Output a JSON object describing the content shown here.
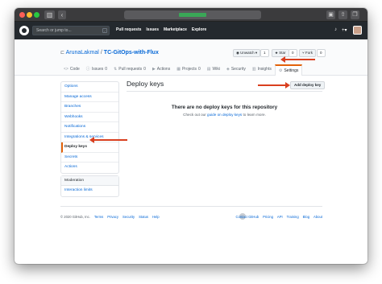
{
  "browser": {
    "nav_back": "‹",
    "nav_sidebar": "▥"
  },
  "header": {
    "search_placeholder": "Search or jump to...",
    "search_kbd": "/",
    "nav": [
      "Pull requests",
      "Issues",
      "Marketplace",
      "Explore"
    ],
    "notifications_icon": "bell-icon",
    "plus_label": "+▾"
  },
  "repo": {
    "owner": "ArunaLakmal",
    "separator": "/",
    "name": "TC-GitOps-with-Flux",
    "unwatch_label": "◉ Unwatch ▾",
    "unwatch_count": "1",
    "star_label": "★ Star",
    "star_count": "0",
    "fork_label": "⑂ Fork",
    "fork_count": "0",
    "tabs": [
      {
        "icon": "<>",
        "label": "Code"
      },
      {
        "icon": "ⓘ",
        "label": "Issues",
        "count": "0"
      },
      {
        "icon": "⇅",
        "label": "Pull requests",
        "count": "0"
      },
      {
        "icon": "▶",
        "label": "Actions"
      },
      {
        "icon": "▦",
        "label": "Projects",
        "count": "0"
      },
      {
        "icon": "▤",
        "label": "Wiki"
      },
      {
        "icon": "◈",
        "label": "Security"
      },
      {
        "icon": "▥",
        "label": "Insights"
      },
      {
        "icon": "⚙",
        "label": "Settings"
      }
    ]
  },
  "sidebar": {
    "items": [
      "Options",
      "Manage access",
      "Branches",
      "Webhooks",
      "Notifications",
      "Integrations & services",
      "Deploy keys",
      "Secrets",
      "Actions"
    ],
    "selected_index": 6,
    "moderation_header": "Moderation",
    "moderation_items": [
      "Interaction limits"
    ]
  },
  "main": {
    "title": "Deploy keys",
    "add_button": "Add deploy key",
    "blank_title": "There are no deploy keys for this repository",
    "blank_sub_prefix": "Check out our",
    "blank_sub_link": "guide on deploy keys",
    "blank_sub_suffix": "to learn more."
  },
  "footer": {
    "copyright": "© 2020 GitHub, Inc.",
    "left_links": [
      "Terms",
      "Privacy",
      "Security",
      "Status",
      "Help"
    ],
    "right_links": [
      "Contact GitHub",
      "Pricing",
      "API",
      "Training",
      "Blog",
      "About"
    ]
  },
  "colors": {
    "accent_arrow": "#d93f1f",
    "active_tab_border": "#e36209",
    "link": "#0366d6",
    "header_bg": "#24292e"
  }
}
